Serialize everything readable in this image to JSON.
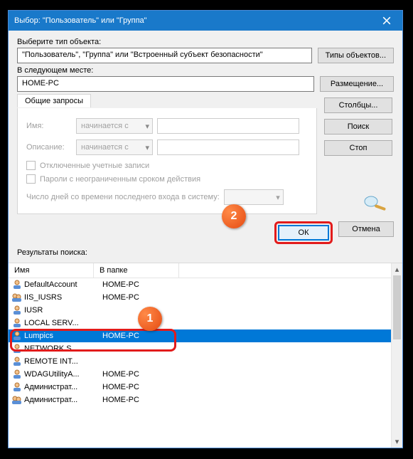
{
  "window": {
    "title": "Выбор: \"Пользователь\" или \"Группа\""
  },
  "labels": {
    "select_object_type": "Выберите тип объекта:",
    "object_type_value": "\"Пользователь\", \"Группа\" или \"Встроенный субъект безопасности\"",
    "location_label": "В следующем месте:",
    "location_value": "HOME-PC"
  },
  "buttons": {
    "object_types": "Типы объектов...",
    "locations": "Размещение...",
    "columns": "Столбцы...",
    "find": "Поиск",
    "stop": "Стоп",
    "ok": "ОК",
    "cancel": "Отмена"
  },
  "queries": {
    "tab_label": "Общие запросы",
    "name_label": "Имя:",
    "desc_label": "Описание:",
    "combo_value": "начинается с",
    "chk_disabled": "Отключенные учетные записи",
    "chk_pwd": "Пароли с неограниченным сроком действия",
    "days_label": "Число дней со времени последнего входа в систему:"
  },
  "results": {
    "label": "Результаты поиска:",
    "col_name": "Имя",
    "col_folder": "В папке",
    "rows": [
      {
        "name": "DefaultAccount",
        "folder": "HOME-PC",
        "icon": "user"
      },
      {
        "name": "IIS_IUSRS",
        "folder": "HOME-PC",
        "icon": "group"
      },
      {
        "name": "IUSR",
        "folder": "",
        "icon": "user"
      },
      {
        "name": "LOCAL SERV...",
        "folder": "",
        "icon": "user"
      },
      {
        "name": "Lumpics",
        "folder": "HOME-PC",
        "icon": "user",
        "selected": true
      },
      {
        "name": "NETWORK S...",
        "folder": "",
        "icon": "user"
      },
      {
        "name": "REMOTE INT...",
        "folder": "",
        "icon": "user"
      },
      {
        "name": "WDAGUtilityA...",
        "folder": "HOME-PC",
        "icon": "user"
      },
      {
        "name": "Администрат...",
        "folder": "HOME-PC",
        "icon": "user"
      },
      {
        "name": "Администрат...",
        "folder": "HOME-PC",
        "icon": "group"
      }
    ]
  },
  "badges": {
    "one": "1",
    "two": "2"
  }
}
